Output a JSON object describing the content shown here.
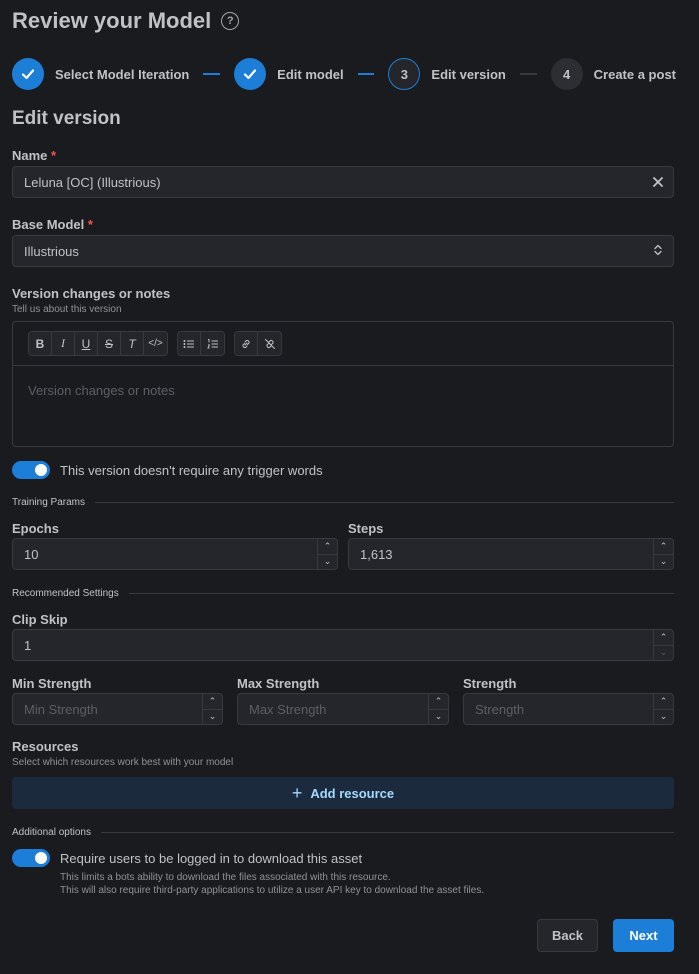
{
  "page": {
    "title": "Review your Model"
  },
  "stepper": {
    "steps": [
      {
        "number": "",
        "label": "Select Model Iteration",
        "state": "done"
      },
      {
        "number": "",
        "label": "Edit model",
        "state": "done"
      },
      {
        "number": "3",
        "label": "Edit version",
        "state": "active"
      },
      {
        "number": "4",
        "label": "Create a post",
        "state": "pending"
      }
    ]
  },
  "section": {
    "title": "Edit version"
  },
  "name_field": {
    "label": "Name",
    "required_mark": "*",
    "value": "Leluna [OC] (Illustrious)"
  },
  "base_model": {
    "label": "Base Model",
    "required_mark": "*",
    "value": "Illustrious"
  },
  "notes": {
    "label": "Version changes or notes",
    "description": "Tell us about this version",
    "placeholder": "Version changes or notes",
    "toolbar": {
      "format": [
        "B",
        "I",
        "U",
        "S",
        "T",
        "</>"
      ],
      "lists": [
        "bullet-list-icon",
        "ordered-list-icon"
      ],
      "links": [
        "link-icon",
        "unlink-icon"
      ]
    }
  },
  "trigger_toggle": {
    "label": "This version doesn't require any trigger words",
    "checked": true
  },
  "training": {
    "divider": "Training Params",
    "epochs": {
      "label": "Epochs",
      "value": "10"
    },
    "steps": {
      "label": "Steps",
      "value": "1,613"
    }
  },
  "recommended": {
    "divider": "Recommended Settings",
    "clip_skip": {
      "label": "Clip Skip",
      "value": "1"
    },
    "min_strength": {
      "label": "Min Strength",
      "placeholder": "Min Strength"
    },
    "max_strength": {
      "label": "Max Strength",
      "placeholder": "Max Strength"
    },
    "strength": {
      "label": "Strength",
      "placeholder": "Strength"
    }
  },
  "resources": {
    "label": "Resources",
    "description": "Select which resources work best with your model",
    "add_button": "Add resource"
  },
  "additional": {
    "divider": "Additional options",
    "login_toggle": {
      "label": "Require users to be logged in to download this asset",
      "checked": true,
      "desc1": "This limits a bots ability to download the files associated with this resource.",
      "desc2": "This will also require third-party applications to utilize a user API key to download the asset files."
    }
  },
  "actions": {
    "back": "Back",
    "next": "Next"
  },
  "colors": {
    "accent": "#1c7ed6",
    "background": "#1a1b1e",
    "input_bg": "#25262b",
    "required": "#fa5252"
  }
}
